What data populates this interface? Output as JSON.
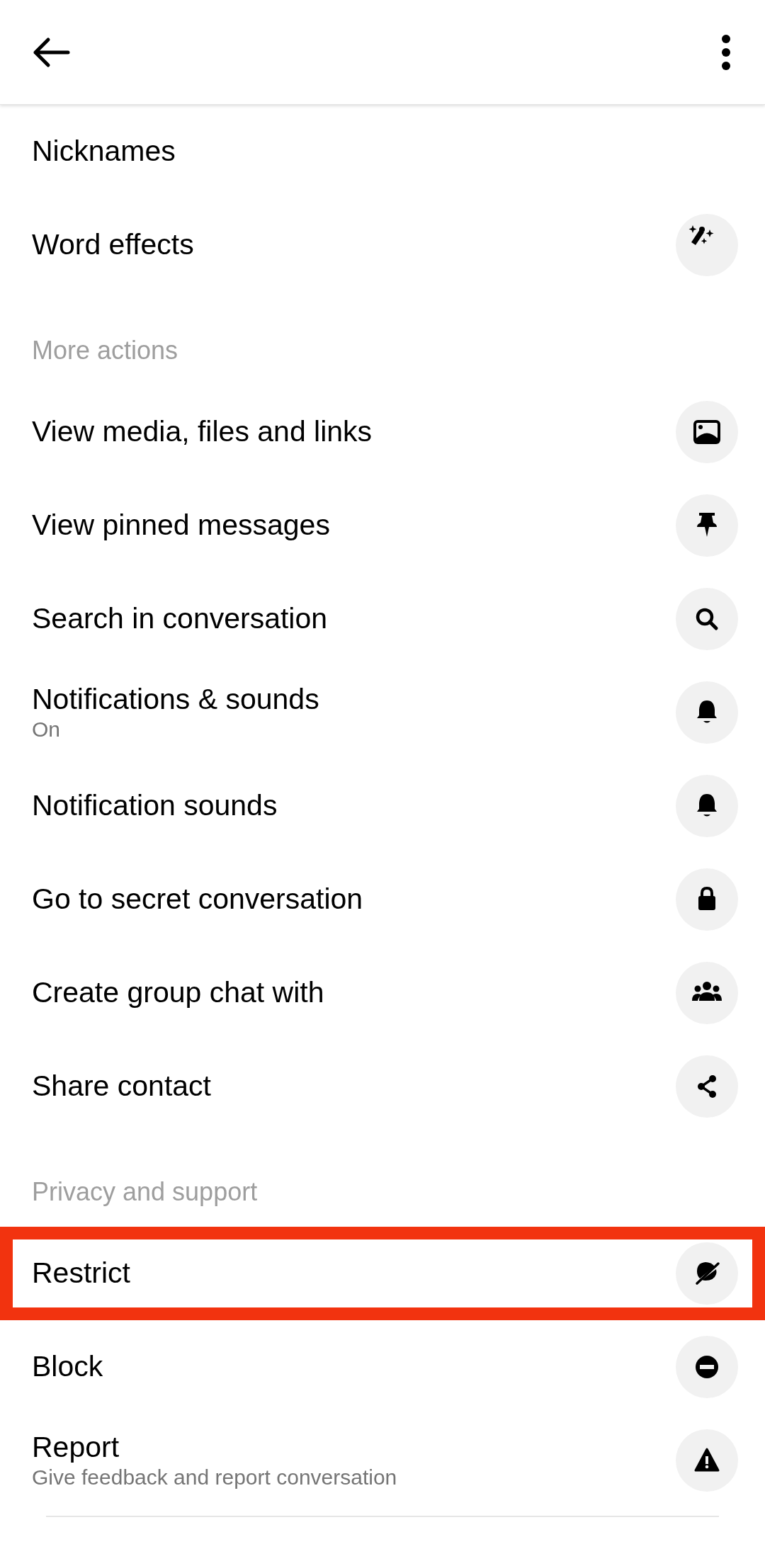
{
  "sections": [
    {
      "items": [
        {
          "title": "Nicknames",
          "highlighted": false
        },
        {
          "title": "Word effects",
          "highlighted": false
        }
      ]
    },
    {
      "header": "More actions",
      "items": [
        {
          "title": "View media, files and links",
          "highlighted": false
        },
        {
          "title": "View pinned messages",
          "highlighted": false
        },
        {
          "title": "Search in conversation",
          "highlighted": false
        },
        {
          "title": "Notifications  & sounds",
          "subtitle": "On",
          "highlighted": false
        },
        {
          "title": "Notification sounds",
          "highlighted": false
        },
        {
          "title": "Go to secret conversation",
          "highlighted": false
        },
        {
          "title": "Create group chat with",
          "highlighted": false
        },
        {
          "title": "Share contact",
          "highlighted": false
        }
      ]
    },
    {
      "header": "Privacy and support",
      "items": [
        {
          "title": "Restrict",
          "highlighted": true
        },
        {
          "title": "Block",
          "highlighted": false
        },
        {
          "title": "Report",
          "subtitle": "Give feedback and report conversation",
          "highlighted": false
        }
      ]
    }
  ]
}
